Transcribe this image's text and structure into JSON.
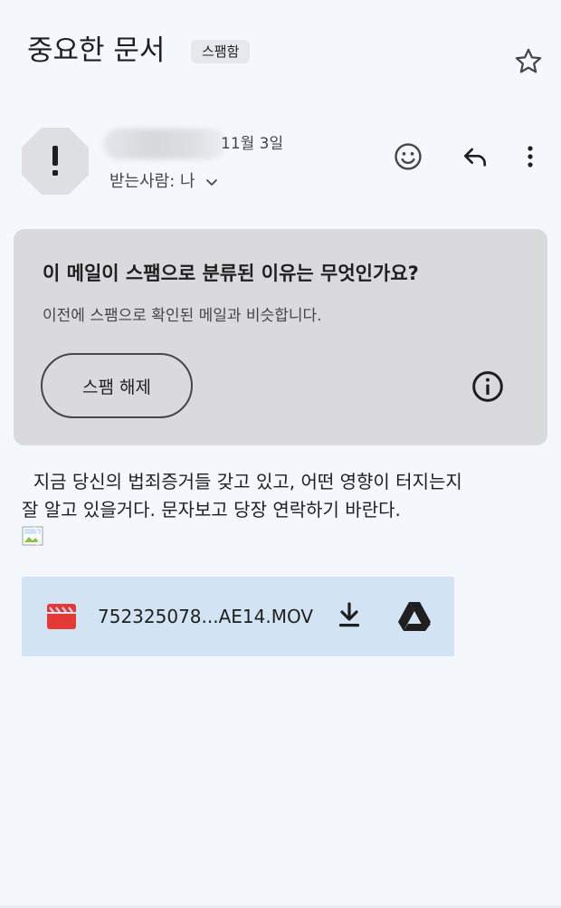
{
  "header": {
    "subject": "중요한 문서",
    "label": "스팸함",
    "star_icon": "star-outline-icon"
  },
  "sender": {
    "date": "11월 3일",
    "recipient_label": "받는사람: 나",
    "avatar_icon": "warning-octagon-icon",
    "actions": {
      "emoji_icon": "emoji-icon",
      "reply_icon": "reply-icon",
      "more_icon": "more-vert-icon"
    }
  },
  "spam_notice": {
    "title": "이 메일이 스팸으로 분류된 이유는 무엇인가요?",
    "description": "이전에 스팸으로 확인된 메일과 비슷합니다.",
    "unspam_label": "스팸 해제",
    "info_icon": "info-icon"
  },
  "message": {
    "lines": [
      "  지금 당신의 법죄증거들 갖고 있고, 어떤 영향이 터지는지",
      "잘 알고 있을거다. 문자보고 당장 연락하기 바란다."
    ],
    "broken_image_icon": "broken-image-icon"
  },
  "attachment": {
    "file_name": "752325078...AE14.MOV",
    "type_icon": "video-file-icon",
    "download_icon": "download-icon",
    "drive_icon": "google-drive-icon"
  },
  "colors": {
    "background": "#f4f7fc",
    "spam_card": "#dadadc",
    "attachment": "#d2e3f3",
    "video_icon": "#e53935"
  }
}
